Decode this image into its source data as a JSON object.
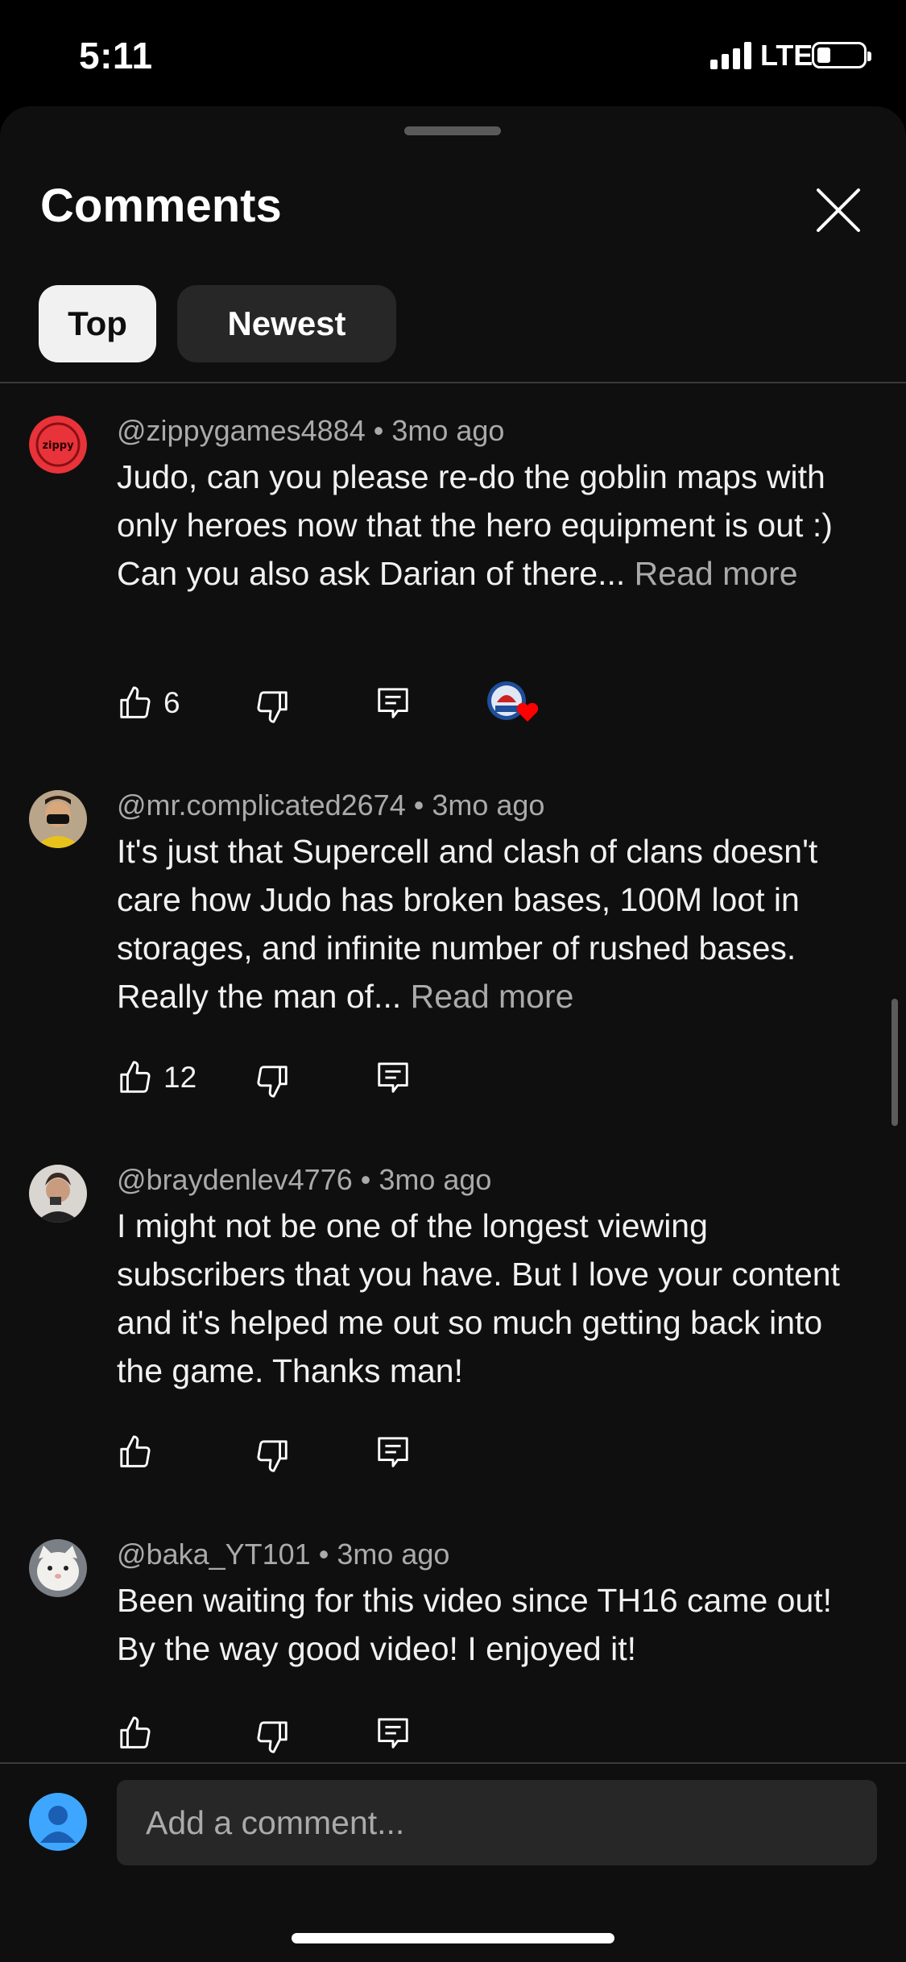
{
  "status_bar": {
    "time": "5:11",
    "network": "LTE",
    "battery_level": 0.25
  },
  "sheet": {
    "title": "Comments",
    "close_icon": "close-icon",
    "tabs": [
      {
        "label": "Top",
        "selected": true
      },
      {
        "label": "Newest",
        "selected": false
      }
    ]
  },
  "comments": [
    {
      "author": "@zippygames4884",
      "time": "3mo ago",
      "text": "Judo, can you please re-do the goblin maps with only heroes now that the hero equipment is out :)\nCan you also ask Darian of there... ",
      "read_more": "Read more",
      "likes": "6",
      "creator_heart": true
    },
    {
      "author": "@mr.complicated2674",
      "time": "3mo ago",
      "text": "It's just that Supercell and clash of clans doesn't care how Judo has broken bases, 100M loot in storages, and infinite number of rushed bases. Really the man of... ",
      "read_more": "Read more",
      "likes": "12"
    },
    {
      "author": "@braydenlev4776",
      "time": "3mo ago",
      "text": "I might not be one of the longest viewing subscribers that you have. But I love your content and it's helped me out so much getting back into the game. Thanks man!",
      "likes": ""
    },
    {
      "author": "@baka_YT101",
      "time": "3mo ago",
      "text": "Been waiting for this video since TH16 came out! By the way good video! I enjoyed it!",
      "likes": ""
    }
  ],
  "composer": {
    "placeholder": "Add a comment..."
  },
  "colors": {
    "background": "#0f0f0f",
    "chip_active": "#f1f1f1",
    "chip_inactive": "#272727",
    "secondary_text": "#aaaaaa",
    "heart": "#ff0000",
    "avatar_blue": "#3ea6ff"
  }
}
